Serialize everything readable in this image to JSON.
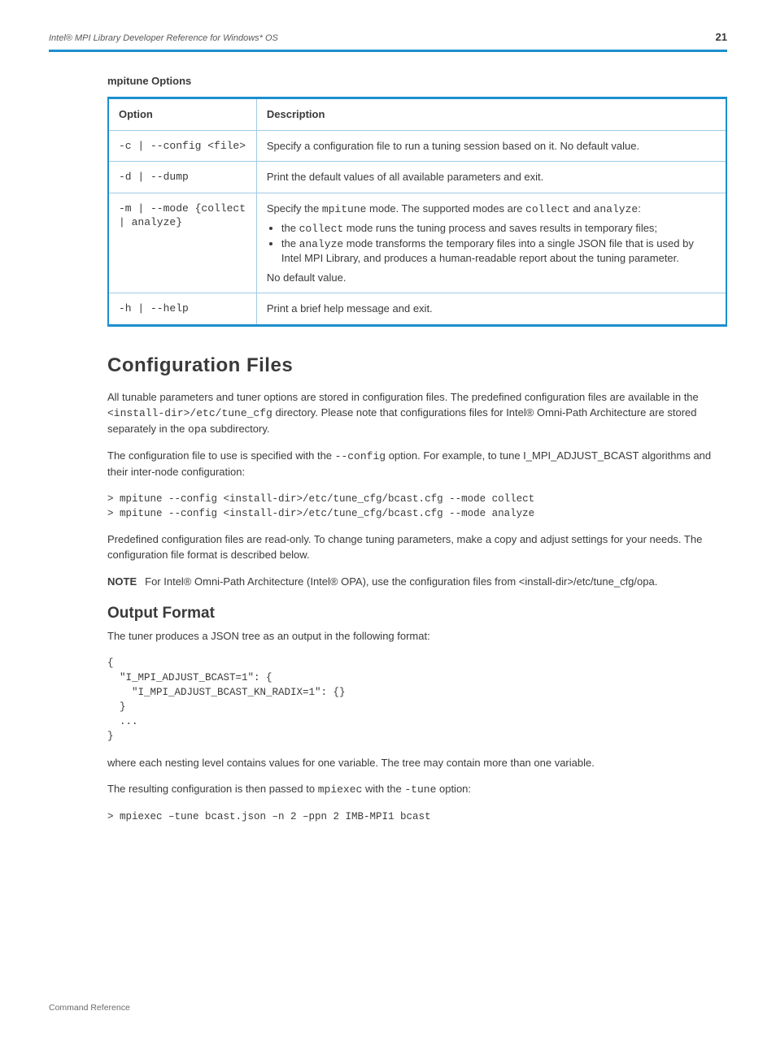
{
  "header": {
    "title_italic": "Intel® MPI Library Developer Reference for Windows* OS",
    "page_number": "21"
  },
  "table": {
    "caption_strong": "mpitune Options",
    "columns": [
      "Option",
      "Description"
    ],
    "rows": [
      {
        "opt": "-c | --config <file>",
        "desc": "Specify a configuration file to run a tuning session based on it. No default value."
      },
      {
        "opt": "-d | --dump",
        "desc": "Print the default values of all available parameters and exit."
      },
      {
        "opt": "-m | --mode {collect | analyze}",
        "desc_pre": "Specify the ",
        "desc_mono": "mpitune",
        "desc_post1": " mode. The supported modes are ",
        "desc_mono1": "collect",
        "desc_post2": " and ",
        "desc_mono2": "analyze",
        "desc_post3": ":",
        "bullets": [
          {
            "pre": "the ",
            "mono": "collect",
            "post": " mode runs the tuning process and saves results in temporary files;"
          },
          {
            "pre": "the ",
            "mono": "analyze",
            "post1": " mode transforms the temporary files into a single JSON file that is used by Intel MPI Library, and produces a human-readable report about the tuning parameter."
          }
        ],
        "desc_tail": "No default value."
      },
      {
        "opt": "-h | --help",
        "desc": "Print a brief help message and exit."
      }
    ]
  },
  "configs": {
    "heading": "Configuration Files",
    "p1a": "All tunable parameters and tuner options are stored in configuration files. The predefined configuration files are available in the ",
    "p1_mono1": "<install-dir>/etc/tune_cfg",
    "p1b": " directory. Please note that configurations files for Intel",
    "p1_reg": "®",
    "p1c": " Omni-Path Architecture are stored separately in the ",
    "p1_mono2": "opa",
    "p1d": " subdirectory.",
    "p2a": "The configuration file to use is specified with the ",
    "p2_mono": "--config",
    "p2b": " option. For example, to tune I_MPI_ADJUST_BCAST algorithms and their inter-node configuration:",
    "code1": "> mpitune --config <install-dir>/etc/tune_cfg/bcast.cfg --mode collect\n> mpitune --config <install-dir>/etc/tune_cfg/bcast.cfg --mode analyze",
    "p3": "Predefined configuration files are read-only. To change tuning parameters, make a copy and adjust settings for your needs. The configuration file format is described below.",
    "note_label": "NOTE",
    "note_text": "For Intel® Omni-Path Architecture (Intel® OPA), use the configuration files from <install-dir>/etc/tune_cfg/opa."
  },
  "output": {
    "heading": "Output Format",
    "p1": "The tuner produces a JSON tree as an output in the following format:",
    "code": "{\n  \"I_MPI_ADJUST_BCAST=1\": {\n    \"I_MPI_ADJUST_BCAST_KN_RADIX=1\": {}\n  }\n  ...\n}",
    "p2": "where each nesting level contains values for one variable. The tree may contain more than one variable.",
    "p3_a": "The resulting configuration is then passed to ",
    "p3_mono1": "mpiexec",
    "p3_b": "  with the ",
    "p3_mono2": "-tune",
    "p3_c": " option:",
    "code2": "> mpiexec –tune bcast.json –n 2 –ppn 2 IMB-MPI1 bcast"
  },
  "footer": "Command Reference"
}
